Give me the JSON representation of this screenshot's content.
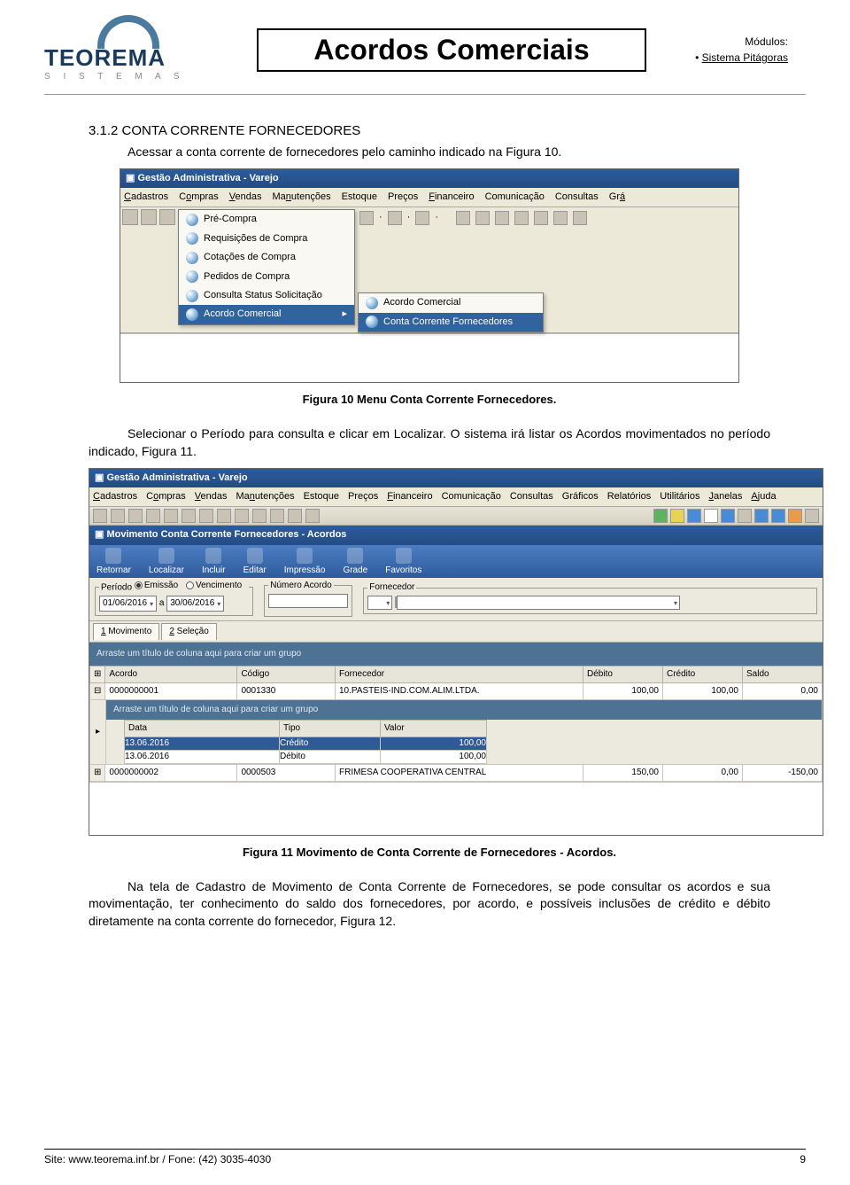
{
  "header": {
    "logo_main": "TEOREMA",
    "logo_sub": "S I S T E M A S",
    "title": "Acordos Comerciais",
    "modulos_label": "Módulos:",
    "modulos": [
      "Sistema Pitágoras"
    ]
  },
  "section": {
    "heading": "3.1.2 CONTA CORRENTE FORNECEDORES",
    "intro": "Acessar a conta corrente de fornecedores pelo caminho indicado na Figura 10.",
    "caption1": "Figura 10 Menu Conta Corrente Fornecedores.",
    "para2a": "Selecionar o Período para consulta e clicar em Localizar. O sistema irá listar os Acordos movimentados no período indicado, Figura 11.",
    "caption2": "Figura 11 Movimento de Conta Corrente de Fornecedores - Acordos.",
    "para3": "Na tela de Cadastro de Movimento de Conta Corrente de Fornecedores, se pode consultar os acordos e sua movimentação, ter conhecimento do saldo dos fornecedores, por acordo, e possíveis inclusões de crédito e débito diretamente na conta corrente do fornecedor, Figura 12."
  },
  "shot1": {
    "window_title": "Gestão Administrativa - Varejo",
    "menu": [
      "Cadastros",
      "Compras",
      "Vendas",
      "Manutenções",
      "Estoque",
      "Preços",
      "Financeiro",
      "Comunicação",
      "Consultas",
      "Grá"
    ],
    "dropdown": [
      "Pré-Compra",
      "Requisições de Compra",
      "Cotações de Compra",
      "Pedidos de Compra",
      "Consulta Status Solicitação",
      "Acordo Comercial"
    ],
    "submenu": [
      "Acordo Comercial",
      "Conta Corrente Fornecedores"
    ]
  },
  "shot2": {
    "window_title": "Gestão Administrativa - Varejo",
    "menu": [
      "Cadastros",
      "Compras",
      "Vendas",
      "Manutenções",
      "Estoque",
      "Preços",
      "Financeiro",
      "Comunicação",
      "Consultas",
      "Gráficos",
      "Relatórios",
      "Utilitários",
      "Janelas",
      "Ajuda"
    ],
    "inner_title": "Movimento Conta Corrente Fornecedores - Acordos",
    "form_toolbar": [
      "Retornar",
      "Localizar",
      "Incluir",
      "Editar",
      "Impressão",
      "Grade",
      "Favoritos"
    ],
    "filters": {
      "periodo_label": "Período",
      "radio_emissao": "Emissão",
      "radio_venc": "Vencimento",
      "date_from": "01/06/2016",
      "date_a": "a",
      "date_to": "30/06/2016",
      "num_label": "Número Acordo",
      "forn_label": "Fornecedor"
    },
    "tabs": [
      "1 Movimento",
      "2 Seleção"
    ],
    "group_hint": "Arraste um título de coluna aqui para criar um grupo",
    "headers": [
      "Acordo",
      "Código",
      "Fornecedor",
      "Débito",
      "Crédito",
      "Saldo"
    ],
    "rows": [
      {
        "acordo": "0000000001",
        "codigo": "0001330",
        "forn": "10.PASTEIS-IND.COM.ALIM.LTDA.",
        "debito": "100,00",
        "credito": "100,00",
        "saldo": "0,00"
      },
      {
        "acordo": "0000000002",
        "codigo": "0000503",
        "forn": "FRIMESA COOPERATIVA CENTRAL",
        "debito": "150,00",
        "credito": "0,00",
        "saldo": "-150,00"
      }
    ],
    "sub_hint": "Arraste um título de coluna aqui para criar um grupo",
    "sub_headers": [
      "Data",
      "Tipo",
      "Valor"
    ],
    "sub_rows": [
      {
        "data": "13.06.2016",
        "tipo": "Crédito",
        "valor": "100,00",
        "sel": true
      },
      {
        "data": "13.06.2016",
        "tipo": "Débito",
        "valor": "100,00",
        "sel": false
      }
    ]
  },
  "footer": {
    "left": "Site: www.teorema.inf.br / Fone: (42) 3035-4030",
    "right": "9"
  }
}
